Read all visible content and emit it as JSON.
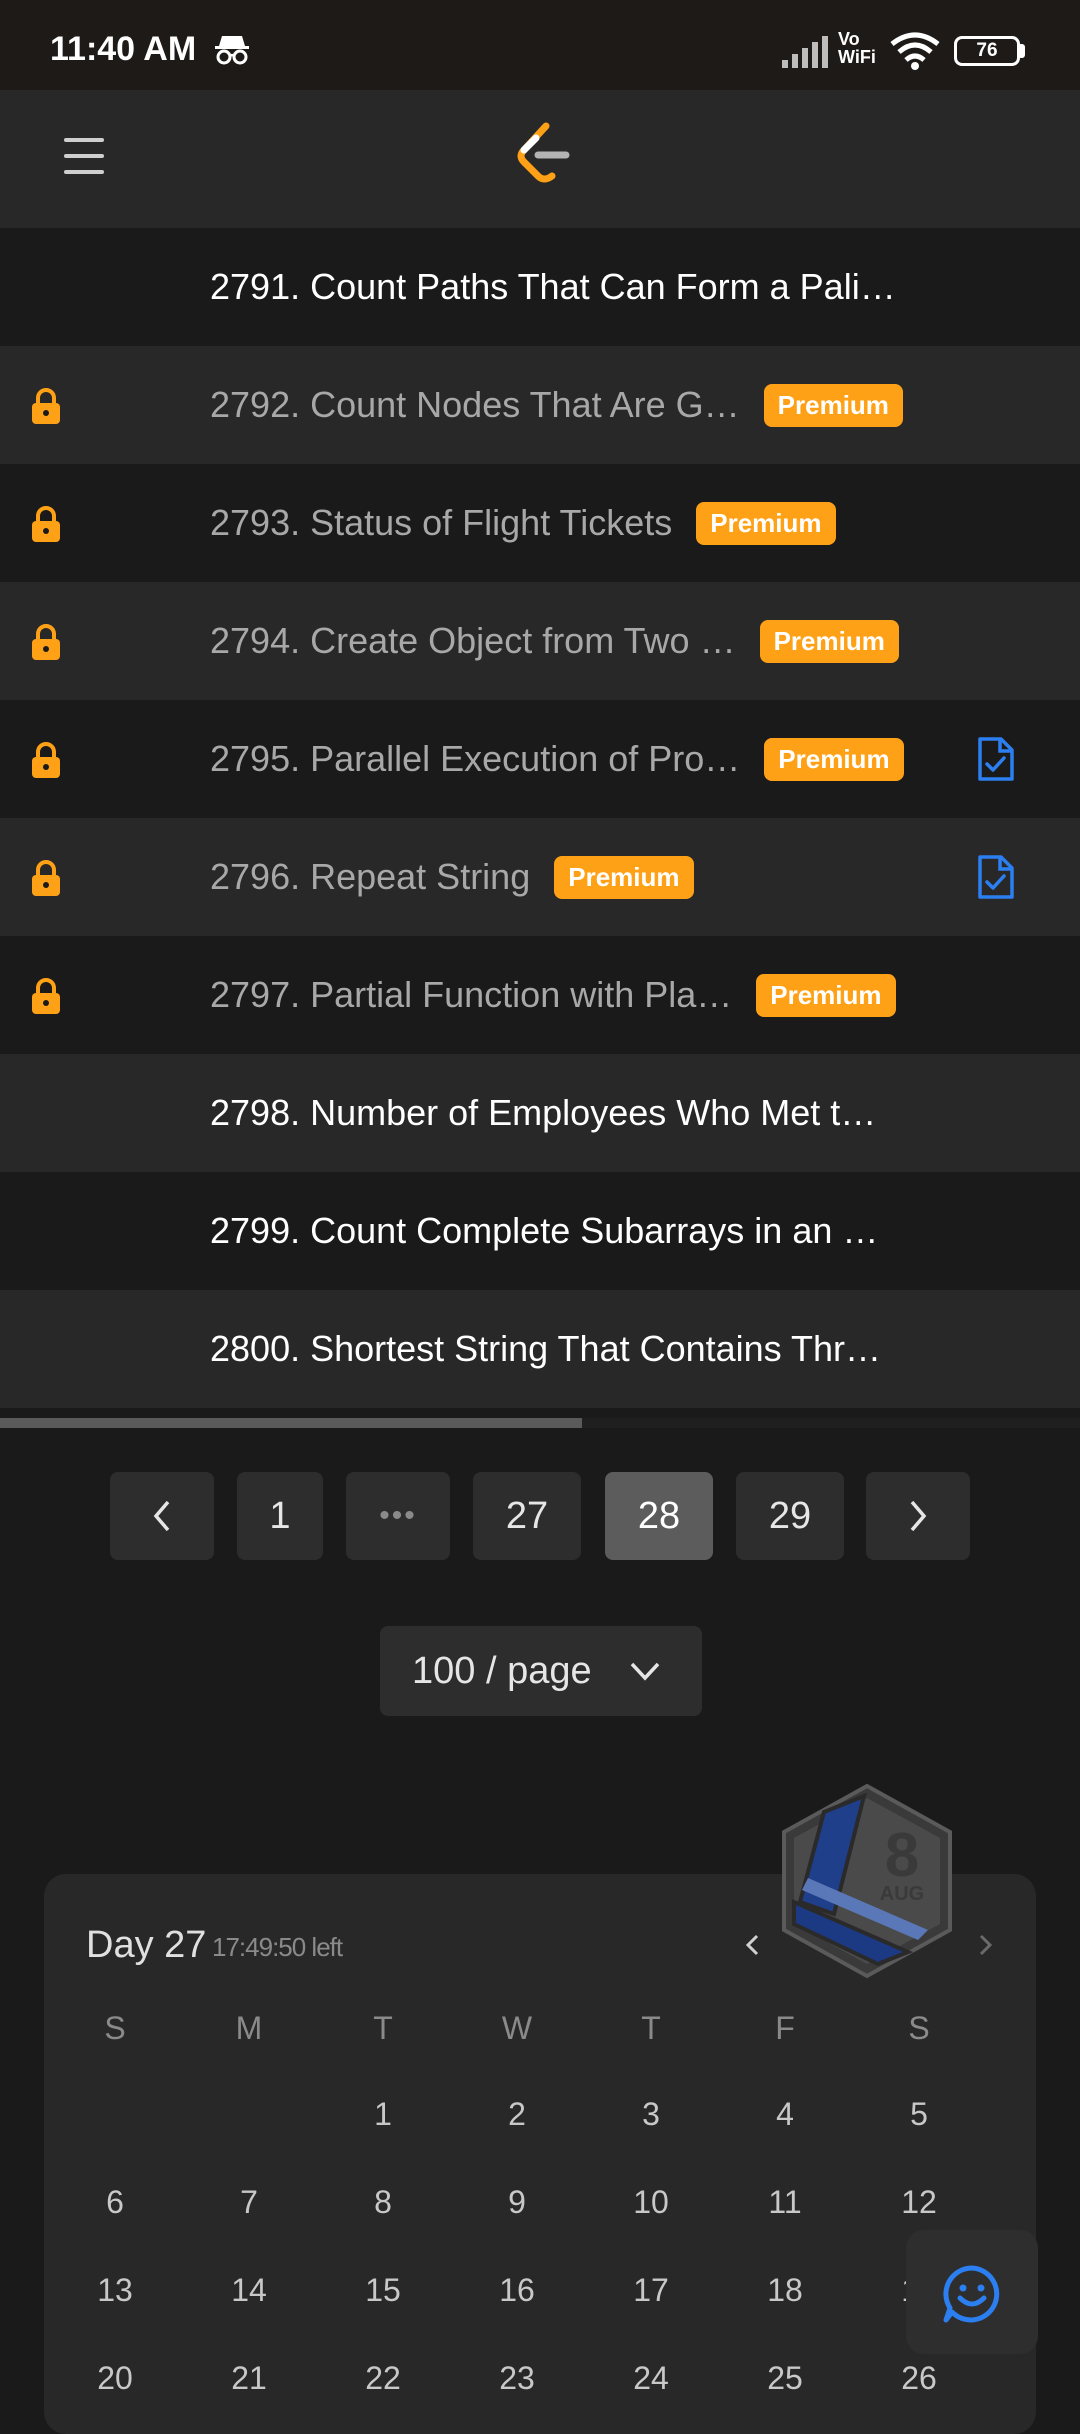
{
  "status_bar": {
    "time": "11:40 AM",
    "vowifi_top": "Vo",
    "vowifi_bottom": "WiFi",
    "battery": "76"
  },
  "colors": {
    "premium": "#ffa116",
    "lock": "#ffa116",
    "solution": "#2c7ff0",
    "bg": "#1a1a1a",
    "row_alt": "#282828"
  },
  "problems": [
    {
      "title": "2791. Count Paths That Can Form a Pali…",
      "locked": false,
      "premium": false,
      "solution": false
    },
    {
      "title": "2792. Count Nodes That Are G…",
      "locked": true,
      "premium": true,
      "solution": false
    },
    {
      "title": "2793. Status of Flight Tickets",
      "locked": true,
      "premium": true,
      "solution": false
    },
    {
      "title": "2794. Create Object from Two …",
      "locked": true,
      "premium": true,
      "solution": false
    },
    {
      "title": "2795. Parallel Execution of Pro…",
      "locked": true,
      "premium": true,
      "solution": true
    },
    {
      "title": "2796. Repeat String",
      "locked": true,
      "premium": true,
      "solution": true
    },
    {
      "title": "2797. Partial Function with Pla…",
      "locked": true,
      "premium": true,
      "solution": false
    },
    {
      "title": "2798. Number of Employees Who Met t…",
      "locked": false,
      "premium": false,
      "solution": false
    },
    {
      "title": "2799. Count Complete Subarrays in an …",
      "locked": false,
      "premium": false,
      "solution": false
    },
    {
      "title": "2800. Shortest String That Contains Thr…",
      "locked": false,
      "premium": false,
      "solution": false
    }
  ],
  "premium_label": "Premium",
  "pagination": {
    "pages": [
      "1",
      "•••",
      "27",
      "28",
      "29"
    ],
    "current": "28",
    "page_size": "100 / page"
  },
  "calendar": {
    "day_label": "Day 27",
    "time_left": "17:49:50 left",
    "badge_day": "8",
    "badge_month": "AUG",
    "weekdays": [
      "S",
      "M",
      "T",
      "W",
      "T",
      "F",
      "S"
    ],
    "weeks": [
      [
        "",
        "",
        "1",
        "2",
        "3",
        "4",
        "5"
      ],
      [
        "6",
        "7",
        "8",
        "9",
        "10",
        "11",
        "12"
      ],
      [
        "13",
        "14",
        "15",
        "16",
        "17",
        "18",
        "19"
      ],
      [
        "20",
        "21",
        "22",
        "23",
        "24",
        "25",
        "26"
      ]
    ]
  }
}
